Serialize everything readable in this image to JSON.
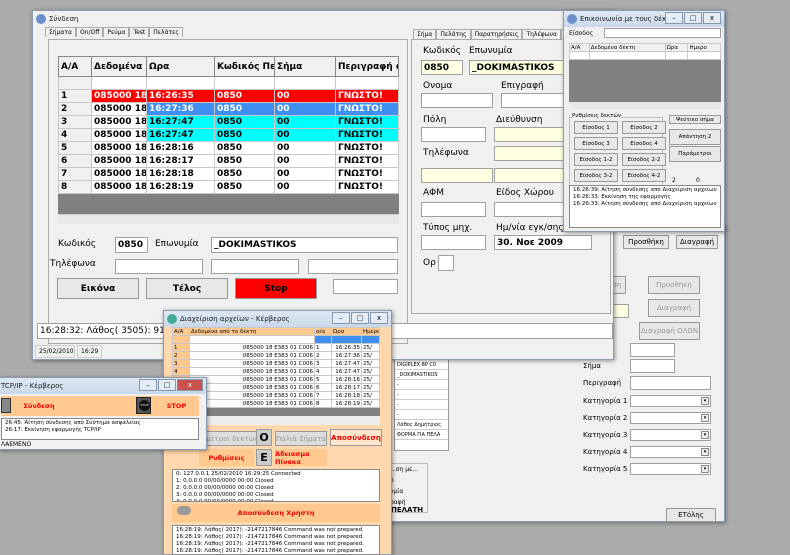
{
  "colors": {
    "desktop": "#ababab",
    "red_row": "#ff0000",
    "blue_row": "#3f8ff0",
    "cyan_row": "#00ffff",
    "orange": "#ffc98f"
  },
  "bg_window": {
    "buttons": [
      "...ση",
      "Προσθήκη",
      "Διαγραφή",
      "Διαγραφή ΟΛΩΝ",
      "Προσθήκη",
      "Διαγραφή",
      "ETόλης"
    ],
    "labels": [
      "Σήμα",
      "Περιγραφή",
      "Κατηγορία 1",
      "Κατηγορία 2",
      "Κατηγορία 3",
      "Κατηγορία 4",
      "Κατηγορία 5"
    ],
    "list": [
      "DIGIPLEX 8P C0",
      "_DOKIMASTIKOS",
      "-",
      "-",
      "-",
      "-",
      "Λάθος Δημήτριος",
      "ΦΟΡΜΑ ΓΙΑ ΠΕΛΑ"
    ],
    "group_title": "...ση με...",
    "group_items": [
      "ό",
      "υμία",
      "ραφή"
    ],
    "footer": "ΠΕΛΑΤΗ"
  },
  "main": {
    "title": "Σύνδεση",
    "tabs": [
      "Σήματα",
      "On/Off",
      "Ρεύμα",
      "Test",
      "Πελάτες"
    ],
    "grid": {
      "headers": [
        "Α/Α",
        "Δεδομένα",
        "Ωρα",
        "Κωδικός Πε",
        "Σήμα",
        "Περιγραφή σ"
      ],
      "rows": [
        [
          "1",
          "085000 18 I",
          "16:26:35",
          "0850",
          "00",
          "ΓΝΩΣΤΟ!"
        ],
        [
          "2",
          "085000 18 I",
          "16:27:36",
          "0850",
          "00",
          "ΓΝΩΣΤΟ!"
        ],
        [
          "3",
          "085000 18 I",
          "16:27:47",
          "0850",
          "00",
          "ΓΝΩΣΤΟ!"
        ],
        [
          "4",
          "085000 18 I",
          "16:27:47",
          "0850",
          "00",
          "ΓΝΩΣΤΟ!"
        ],
        [
          "5",
          "085000 18 I",
          "16:28:16",
          "0850",
          "00",
          "ΓΝΩΣΤΟ!"
        ],
        [
          "6",
          "085000 18 I",
          "16:28:17",
          "0850",
          "00",
          "ΓΝΩΣΤΟ!"
        ],
        [
          "7",
          "085000 18 I",
          "16:28:18",
          "0850",
          "00",
          "ΓΝΩΣΤΟ!"
        ],
        [
          "8",
          "085000 18 I",
          "16:28:19",
          "0850",
          "00",
          "ΓΝΩΣΤΟ!"
        ]
      ]
    },
    "code_label": "Κωδικός",
    "code": "0850",
    "name_label": "Επωνυμία",
    "name": "_DOKIMASTIKOS",
    "phone_label": "Τηλέφωνα",
    "btn_image": "Εικόνα",
    "btn_end": "Τέλος",
    "btn_stop": "Stop",
    "status_msg": "16:28:32:  Λάθος( 3505):  91",
    "status_date": "25/02/2010",
    "status_time": "16:29",
    "right_tabs": [
      "Σήμα",
      "Πελάτης",
      "Παρατηρήσεις",
      "Τηλέφωνα",
      "Πρόσβαση"
    ],
    "customer": {
      "code_label": "Κωδικός",
      "code": "0850",
      "name_label": "Επωνυμία",
      "name": "_DOKIMASTIKOS",
      "first_label": "Ονομα",
      "sign_label": "Επιγραφή",
      "city_label": "Πόλη",
      "addr_label": "Διεύθυνση",
      "phone_label": "Τηλέφωνα",
      "afm_label": "ΑΦΜ",
      "space_label": "Είδος Χώρου",
      "type_label": "Τύπος μηχ.",
      "date_label": "Ημ/νία εγκ/σης",
      "date": "30. Νοε 2009",
      "op_label": "Ορ"
    }
  },
  "comm": {
    "title": "Επικοινωνία με τους δέκτες - Κέρ...",
    "input_label": "Είσοδος",
    "headers": [
      "Α/Α",
      "Δεδομένα δέκτη",
      "Ωρα",
      "Ημερο"
    ],
    "group": "Ρυθμίσεις δεκτών",
    "inputs": [
      "Είσοδος 1",
      "Είσοδος 2",
      "Είσοδος 3",
      "Είσοδος 4",
      "Είσοδος 1-2",
      "Είσοδος 2-2",
      "Είσοδος 3-2",
      "Είσοδος 4-2"
    ],
    "side": [
      "Ψεύτικο σήμα",
      "Απάντηση 2",
      "Παράμετροι"
    ],
    "count_a": "2",
    "count_b": "0",
    "log": [
      "16:26:39:  Αίτηση σύνδεσης από Διαχείριση αρχείων",
      "16:26:33:  Εκκίνηση της εφαρμογής",
      "16:26:33:  Αίτηση σύνδεσης από Διαχείριση αρχείων"
    ]
  },
  "files": {
    "title": "Διαχείριση αρχείων - Κέρβερος",
    "headers": [
      "Α/Α",
      "Δεδομένα από το δέκτη",
      "α/α",
      "Ωρα",
      "Ημερο"
    ],
    "rows": [
      [
        "1",
        "085000 18 E383 01 C006",
        "1",
        "16:26:35",
        "25/"
      ],
      [
        "2",
        "085000 18 E383 01 C006",
        "2",
        "16:27:36",
        "25/"
      ],
      [
        "3",
        "085000 18 E383 01 C006",
        "3",
        "16:27:47",
        "25/"
      ],
      [
        "4",
        "085000 18 E383 01 C006",
        "4",
        "16:27:47",
        "25/"
      ],
      [
        "5",
        "085000 18 E383 01 C006",
        "5",
        "16:28:16",
        "25/"
      ],
      [
        "6",
        "085000 18 E383 01 C006",
        "6",
        "16:28:17",
        "25/"
      ],
      [
        "7",
        "085000 18 E383 01 C006",
        "7",
        "16:28:18",
        "25/"
      ],
      [
        "8",
        "085000 18 E383 01 C006",
        "8",
        "16:28:19",
        "25/"
      ]
    ],
    "btn_receivers": "...μετροι δεκτών",
    "btn_old": "Παλιά Σήματα",
    "btn_disconnect": "Αποσύνδεση",
    "btn_settings": "Ρυθμίσεις",
    "btn_clear": "Άδειασμα Πίνακα",
    "icon_o": "O",
    "icon_e": "E",
    "conn_log": [
      "0: 127.0.0.1 25/02/2010 16:29:25 Connected",
      "1: 0.0.0.0 00/00/0000 00:00 Closed",
      "2: 0.0.0.0 00/00/0000 00:00 Closed",
      "3: 0.0.0.0 00/00/0000 00:00 Closed",
      "4: 0.0.0.0 00/00/0000 00:00 Closed"
    ],
    "btn_user_disconnect": "Αποσύνδεση Χρήστη",
    "err_log": [
      "16:28:19:   Λάθος( 2017):  -2147217846 Command was not prepared.",
      "16:28:19:   Λάθος( 2017):  -2147217846 Command was not prepared.",
      "16:28:19:   Λάθος( 2017):  -2147217846 Command was not prepared.",
      "16:28:19:   Λάθος( 2017):  -2147217846 Command was not prepared.",
      "16:28:19:   Λάθος( 2017):  -2147217846 Command was not prepared."
    ]
  },
  "tcp": {
    "title": "TCP/IP - Κέρβερος",
    "btn_connect": "Σύνδεση",
    "btn_stop": "STOP",
    "stop_icon": "STOP",
    "log": [
      "26:45:  Αίτηση σύνδεσης από Σύστημα ασφαλείας",
      "26:17:  Εκκίνηση εφαρμογής TCP/IP"
    ],
    "status": "ΛΑΕΜΕΝΟ"
  }
}
